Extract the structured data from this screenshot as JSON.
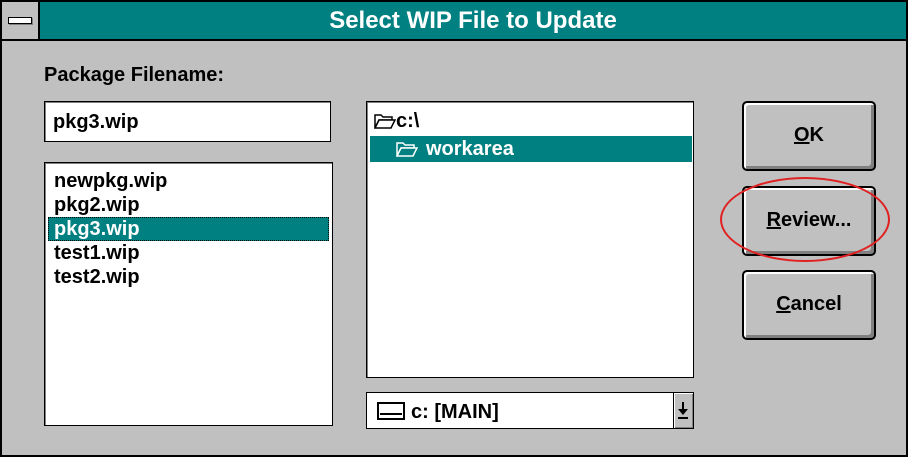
{
  "window": {
    "title": "Select WIP File to Update"
  },
  "package_filename": {
    "label": "Package Filename:",
    "value": "pkg3.wip"
  },
  "files": {
    "items": [
      "newpkg.wip",
      "pkg2.wip",
      "pkg3.wip",
      "test1.wip",
      "test2.wip"
    ],
    "selected": "pkg3.wip"
  },
  "directories": {
    "items": [
      {
        "label": "c:\\",
        "icon": "open-folder-icon"
      },
      {
        "label": "workarea",
        "icon": "open-folder-icon"
      }
    ],
    "selected": "workarea"
  },
  "drive": {
    "value": "c: [MAIN]",
    "icon": "drive-icon"
  },
  "buttons": {
    "ok": {
      "mnemonic": "O",
      "rest": "K"
    },
    "review": {
      "mnemonic": "R",
      "rest": "eview..."
    },
    "cancel": {
      "mnemonic": "C",
      "rest": "ancel"
    }
  },
  "colors": {
    "titlebar": "#008080",
    "selection": "#008080",
    "face": "#c0c0c0",
    "annotation": "#e02020"
  }
}
